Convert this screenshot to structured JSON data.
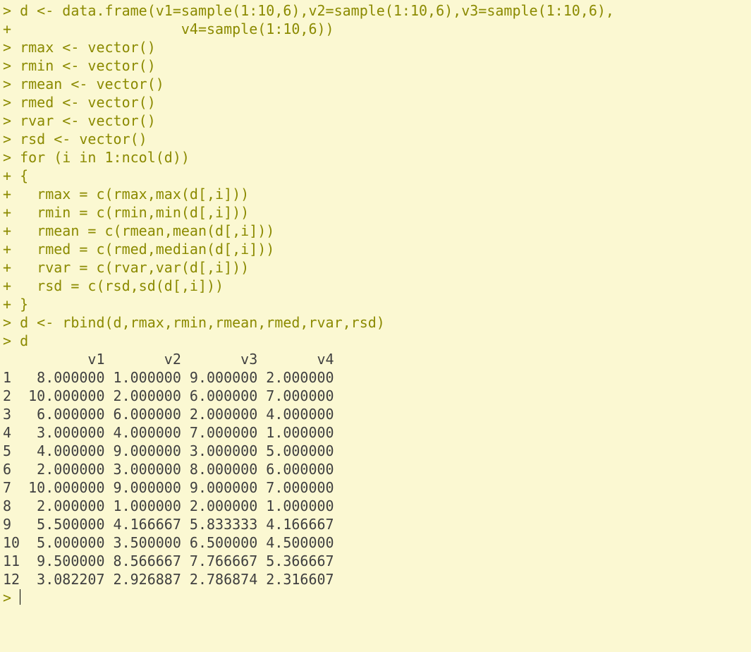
{
  "lines": [
    {
      "cls": "input",
      "text": "> d <- data.frame(v1=sample(1:10,6),v2=sample(1:10,6),v3=sample(1:10,6),"
    },
    {
      "cls": "input",
      "text": "+                    v4=sample(1:10,6))"
    },
    {
      "cls": "input",
      "text": "> rmax <- vector()"
    },
    {
      "cls": "input",
      "text": "> rmin <- vector()"
    },
    {
      "cls": "input",
      "text": "> rmean <- vector()"
    },
    {
      "cls": "input",
      "text": "> rmed <- vector()"
    },
    {
      "cls": "input",
      "text": "> rvar <- vector()"
    },
    {
      "cls": "input",
      "text": "> rsd <- vector()"
    },
    {
      "cls": "input",
      "text": "> for (i in 1:ncol(d))"
    },
    {
      "cls": "input",
      "text": "+ {"
    },
    {
      "cls": "input",
      "text": "+   rmax = c(rmax,max(d[,i]))"
    },
    {
      "cls": "input",
      "text": "+   rmin = c(rmin,min(d[,i]))"
    },
    {
      "cls": "input",
      "text": "+   rmean = c(rmean,mean(d[,i]))"
    },
    {
      "cls": "input",
      "text": "+   rmed = c(rmed,median(d[,i]))"
    },
    {
      "cls": "input",
      "text": "+   rvar = c(rvar,var(d[,i]))"
    },
    {
      "cls": "input",
      "text": "+   rsd = c(rsd,sd(d[,i]))"
    },
    {
      "cls": "input",
      "text": "+ }"
    },
    {
      "cls": "input",
      "text": "> d <- rbind(d,rmax,rmin,rmean,rmed,rvar,rsd)"
    },
    {
      "cls": "input",
      "text": "> d"
    },
    {
      "cls": "output",
      "text": "          v1       v2       v3       v4"
    },
    {
      "cls": "output",
      "text": "1   8.000000 1.000000 9.000000 2.000000"
    },
    {
      "cls": "output",
      "text": "2  10.000000 2.000000 6.000000 7.000000"
    },
    {
      "cls": "output",
      "text": "3   6.000000 6.000000 2.000000 4.000000"
    },
    {
      "cls": "output",
      "text": "4   3.000000 4.000000 7.000000 1.000000"
    },
    {
      "cls": "output",
      "text": "5   4.000000 9.000000 3.000000 5.000000"
    },
    {
      "cls": "output",
      "text": "6   2.000000 3.000000 8.000000 6.000000"
    },
    {
      "cls": "output",
      "text": "7  10.000000 9.000000 9.000000 7.000000"
    },
    {
      "cls": "output",
      "text": "8   2.000000 1.000000 2.000000 1.000000"
    },
    {
      "cls": "output",
      "text": "9   5.500000 4.166667 5.833333 4.166667"
    },
    {
      "cls": "output",
      "text": "10  5.000000 3.500000 6.500000 4.500000"
    },
    {
      "cls": "output",
      "text": "11  9.500000 8.566667 7.766667 5.366667"
    },
    {
      "cls": "output",
      "text": "12  3.082207 2.926887 2.786874 2.316607"
    }
  ],
  "prompt": "> "
}
